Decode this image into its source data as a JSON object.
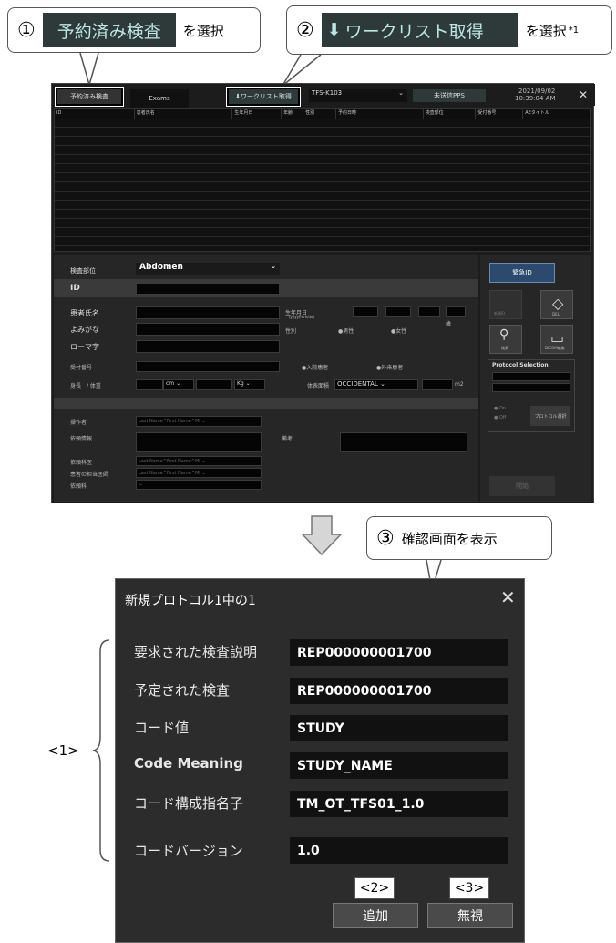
{
  "callouts": {
    "c1": {
      "num": "①",
      "button": "予約済み検査",
      "text": "を選択"
    },
    "c2": {
      "num": "②",
      "button": "ワークリスト取得",
      "text": "を選択",
      "note": "*1"
    },
    "c3": {
      "num": "③",
      "text": "確認画面を表示"
    }
  },
  "app": {
    "tabs": [
      "予約済み検査",
      "Exams"
    ],
    "worklist_button": "ワークリスト取得",
    "station": "TFS-K103",
    "unsent_pps": "未送信PPS",
    "date": "2021/09/02",
    "time": "10:39:04 AM",
    "columns": [
      "ID",
      "患者氏名",
      "生年月日",
      "年齢",
      "性別",
      "予約日時",
      "検査部位",
      "受付番号",
      "AEタイトル"
    ],
    "form": {
      "body_part_label": "検査部位",
      "body_part_value": "Abdomen",
      "id_label": "ID",
      "patient_name_label": "患者氏名",
      "furigana_label": "よみがな",
      "romaji_label": "ローマ字",
      "dob_label": "生年月日",
      "dob_format": "(yyyy/mm/dd)",
      "age_unit": "歳",
      "sex_label": "性別",
      "male": "男性",
      "female": "女性",
      "accession_label": "受付番号",
      "inpatient": "入院患者",
      "outpatient": "外来患者",
      "height_weight_label": "身長　/ 体重",
      "cm": "cm",
      "kg": "Kg",
      "body_type_label": "体表面積",
      "body_type_value": "OCCIDENTAL",
      "m2": "m2",
      "operator_label": "操作者",
      "name_placeholder": "Last Name^First Name^MI",
      "exam_info_label": "依頼情報",
      "remarks_label": "備考",
      "ref_dept_label": "依頼科医",
      "phys_label": "患者の担当医師",
      "inst_label": "依頼科",
      "emergency_id": "緊急ID",
      "new_label": "新規ID",
      "delete_label": "DEL",
      "search_label": "検索",
      "dicom_label": "DICOM編集",
      "protocol_title": "Protocol Selection",
      "on": "On",
      "off": "Off",
      "protocol_btn": "プロトコル選択",
      "start": "開始"
    }
  },
  "dialog": {
    "title": "新規プロトコル1中の1",
    "rows": [
      {
        "label": "要求された検査説明",
        "value": "REP000000001700"
      },
      {
        "label": "予定された検査",
        "value": "REP000000001700"
      },
      {
        "label": "コード値",
        "value": "STUDY"
      },
      {
        "label": "Code Meaning",
        "value": "STUDY_NAME"
      },
      {
        "label": "コード構成指名子",
        "value": "TM_OT_TFS01_1.0"
      },
      {
        "label": "コードバージョン",
        "value": "1.0"
      }
    ],
    "add": "追加",
    "ignore": "無視",
    "num2": "<2>",
    "num3": "<3>"
  },
  "bracket_label": "<1>"
}
